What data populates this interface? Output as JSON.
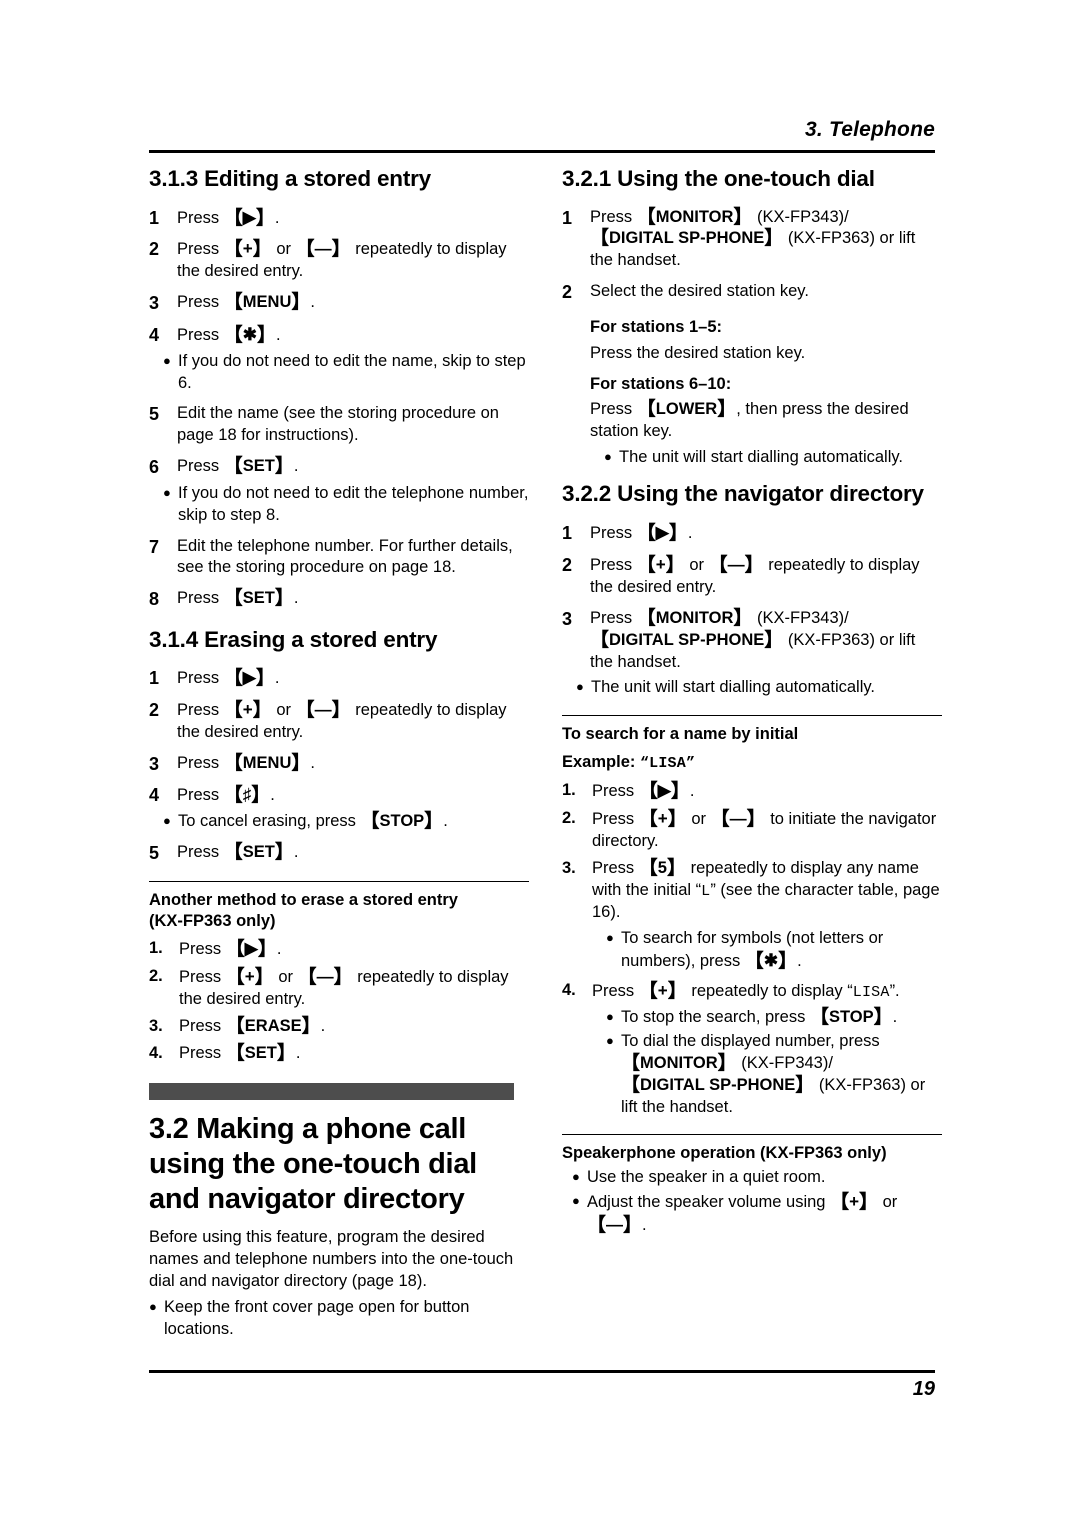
{
  "header": {
    "chapter": "3. Telephone"
  },
  "footer": {
    "page_number": "19"
  },
  "keys": {
    "right_arrow": "▶",
    "plus": "+",
    "minus": "—",
    "star": "✱",
    "sharp": "♯",
    "bracket_open": "【",
    "bracket_close": "】",
    "bullet": "●"
  },
  "left_column": {
    "section_313": {
      "heading": "3.1.3 Editing a stored entry",
      "steps": [
        {
          "num": "1",
          "text_pre": "Press ",
          "key": "▶",
          "text_post": "."
        },
        {
          "num": "2",
          "text": "Press [+] or [—] repeatedly to display the desired entry."
        },
        {
          "num": "3",
          "text_pre": "Press ",
          "key": "MENU",
          "text_post": "."
        },
        {
          "num": "4",
          "text_pre": "Press ",
          "key": "✱",
          "text_post": ".",
          "bullet": "If you do not need to edit the name, skip to step 6."
        },
        {
          "num": "5",
          "text": "Edit the name (see the storing procedure on page 18 for instructions)."
        },
        {
          "num": "6",
          "text_pre": "Press ",
          "key": "SET",
          "text_post": ".",
          "bullet": "If you do not need to edit the telephone number, skip to step 8."
        },
        {
          "num": "7",
          "text": "Edit the telephone number. For further details, see the storing procedure on page 18."
        },
        {
          "num": "8",
          "text_pre": "Press ",
          "key": "SET",
          "text_post": "."
        }
      ]
    },
    "section_314": {
      "heading": "3.1.4 Erasing a stored entry",
      "steps": [
        {
          "num": "1",
          "text_pre": "Press ",
          "key": "▶",
          "text_post": "."
        },
        {
          "num": "2",
          "text": "Press [+] or [—] repeatedly to display the desired entry."
        },
        {
          "num": "3",
          "text_pre": "Press ",
          "key": "MENU",
          "text_post": "."
        },
        {
          "num": "4",
          "text_pre": "Press ",
          "key": "♯",
          "text_post": ".",
          "bullet_pre": "To cancel erasing, press ",
          "bullet_key": "STOP",
          "bullet_post": "."
        },
        {
          "num": "5",
          "text_pre": "Press ",
          "key": "SET",
          "text_post": "."
        }
      ]
    },
    "note_another_method": {
      "title_line1": "Another method to erase a stored entry",
      "title_line2": "(KX-FP363 only)",
      "steps": [
        {
          "num": "1.",
          "text_pre": "Press ",
          "key": "▶",
          "text_post": "."
        },
        {
          "num": "2.",
          "text": "Press [+] or [—] repeatedly to display the desired entry."
        },
        {
          "num": "3.",
          "text_pre": "Press ",
          "key": "ERASE",
          "text_post": "."
        },
        {
          "num": "4.",
          "text_pre": "Press ",
          "key": "SET",
          "text_post": "."
        }
      ]
    },
    "section_32": {
      "heading": "3.2 Making a phone call using the one-touch dial and navigator directory",
      "intro": "Before using this feature, program the desired names and telephone numbers into the one-touch dial and navigator directory (page 18).",
      "bullet": "Keep the front cover page open for button locations."
    }
  },
  "right_column": {
    "section_321": {
      "heading": "3.2.1 Using the one-touch dial",
      "step1": {
        "num": "1",
        "pre": "Press ",
        "key1": "MONITOR",
        "mid1": " (KX-FP343)/",
        "key2": "DIGITAL SP-PHONE",
        "post": " (KX-FP363) or lift the handset."
      },
      "step2": {
        "num": "2",
        "text": "Select the desired station key."
      },
      "stations_1_5_title": "For stations 1–5:",
      "stations_1_5_text": "Press the desired station key.",
      "stations_6_10_title": "For stations 6–10:",
      "stations_6_10_pre": "Press ",
      "stations_6_10_key": "LOWER",
      "stations_6_10_post": ", then press the desired station key.",
      "auto_dial_bullet": "The unit will start dialling automatically."
    },
    "section_322": {
      "heading": "3.2.2 Using the navigator directory",
      "steps": [
        {
          "num": "1",
          "text_pre": "Press ",
          "key": "▶",
          "text_post": "."
        },
        {
          "num": "2",
          "text": "Press [+] or [—] repeatedly to display the desired entry."
        }
      ],
      "step3": {
        "num": "3",
        "pre": "Press ",
        "key1": "MONITOR",
        "mid1": " (KX-FP343)/",
        "key2": "DIGITAL SP-PHONE",
        "post": " (KX-FP363) or lift the handset.",
        "bullet": "The unit will start dialling automatically."
      }
    },
    "note_search": {
      "title": "To search for a name by initial",
      "example_label": "Example: ",
      "example_value": "“LISA”",
      "step1": {
        "num": "1.",
        "pre": "Press ",
        "key": "▶",
        "post": "."
      },
      "step2": {
        "num": "2.",
        "text": "Press [+] or [—] to initiate the navigator directory."
      },
      "step3": {
        "num": "3.",
        "pre": "Press ",
        "key": "5",
        "mid": " repeatedly to display any name with the initial “",
        "initial": "L",
        "post": "” (see the character table, page 16).",
        "bullet_pre": "To search for symbols (not letters or numbers), press ",
        "bullet_key": "✱",
        "bullet_post": "."
      },
      "step4": {
        "num": "4.",
        "pre": "Press ",
        "key": "+",
        "mid": " repeatedly to display “",
        "value": "LISA",
        "post": "”.",
        "bullet1_pre": "To stop the search, press ",
        "bullet1_key": "STOP",
        "bullet1_post": ".",
        "bullet2_pre": "To dial the displayed number, press ",
        "bullet2_key1": "MONITOR",
        "bullet2_mid": " (KX-FP343)/",
        "bullet2_key2": "DIGITAL SP-PHONE",
        "bullet2_post": " (KX-FP363) or lift the handset."
      }
    },
    "note_speakerphone": {
      "title": "Speakerphone operation (KX-FP363 only)",
      "bullet1": "Use the speaker in a quiet room.",
      "bullet2_pre": "Adjust the speaker volume using ",
      "bullet2_post": "."
    }
  }
}
